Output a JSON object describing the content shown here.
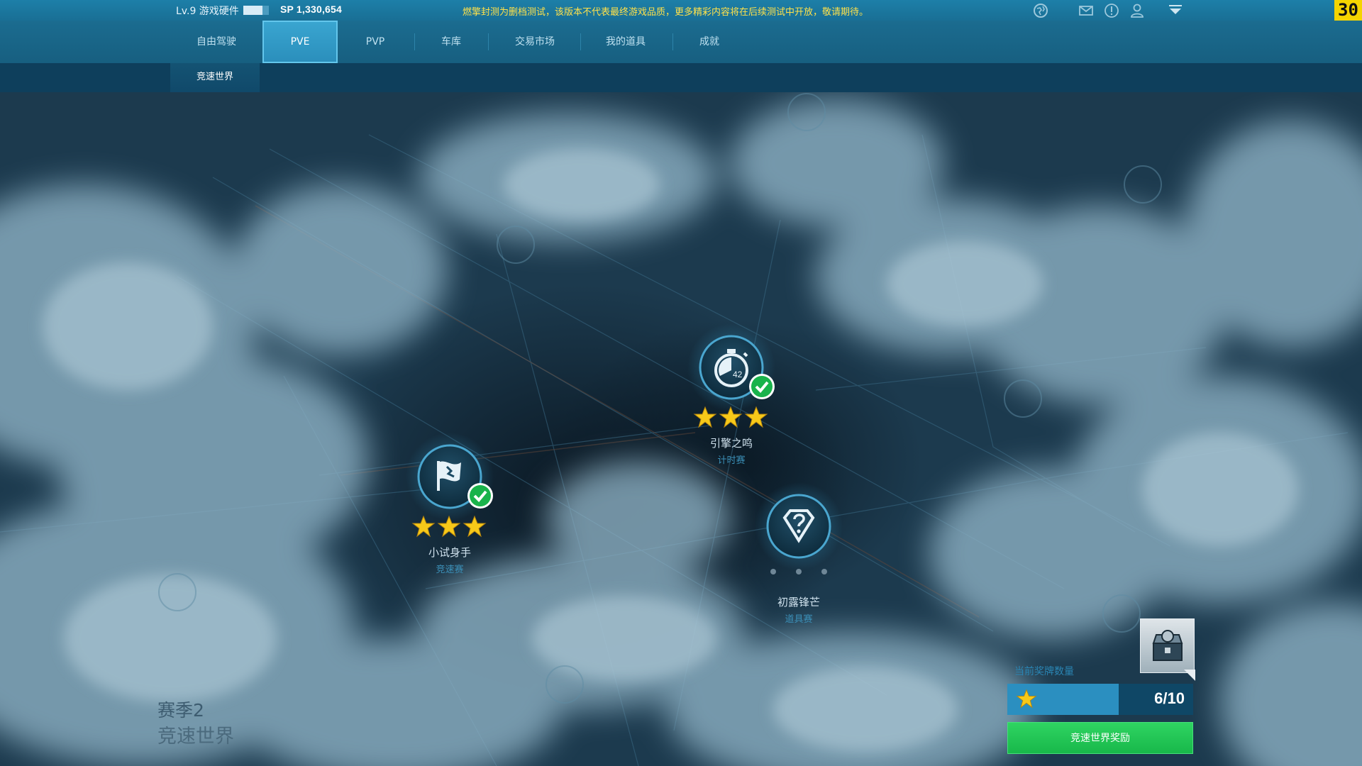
{
  "topbar": {
    "level_text": "Lv.9 游戏硬件",
    "level_progress": 0.75,
    "sp_text": "SP 1,330,654",
    "notice": "燃擎封测为删档测试，该版本不代表最终游戏品质，更多精彩内容将在后续测试中开放，敬请期待。",
    "icons": [
      "globe-icon",
      "mail-icon",
      "alert-icon",
      "user-icon",
      "dropdown-menu-icon"
    ],
    "fps": "30",
    "fps_color": "#f5d400",
    "notice_color": "#ffe14a"
  },
  "nav": {
    "tabs": [
      {
        "label": "自由驾驶",
        "active": false
      },
      {
        "label": "PVE",
        "active": true
      },
      {
        "label": "PVP",
        "active": false
      },
      {
        "label": "车库",
        "active": false
      },
      {
        "label": "交易市场",
        "active": false
      },
      {
        "label": "我的道具",
        "active": false
      },
      {
        "label": "成就",
        "active": false
      }
    ],
    "active_color": "#3aa6d1"
  },
  "subnav": {
    "tabs": [
      {
        "label": "竞速世界",
        "active": true
      }
    ]
  },
  "map": {
    "nodes": [
      {
        "title": "小试身手",
        "mode": "竞速赛",
        "icon": "race-flag-icon",
        "completed": true,
        "stars": 3
      },
      {
        "title": "引擎之鸣",
        "mode": "计时赛",
        "icon": "stopwatch-icon",
        "stopwatch_value": "42",
        "completed": true,
        "stars": 3
      },
      {
        "title": "初露锋芒",
        "mode": "道具赛",
        "icon": "mystery-item-icon",
        "completed": false,
        "stars": 0
      }
    ],
    "background_icons": [
      "flag-icon",
      "music-icon",
      "skull-icon",
      "flag-icon",
      "music-icon",
      "flag-icon",
      "question-icon"
    ],
    "season_line1": "赛季2",
    "season_line2": "竞速世界"
  },
  "reward": {
    "label": "当前奖牌数量",
    "count_text": "6/10",
    "current": 6,
    "total": 10,
    "button_label": "竞速世界奖励",
    "chest_icon": "treasure-chest-icon",
    "button_color": "#1fc452"
  }
}
